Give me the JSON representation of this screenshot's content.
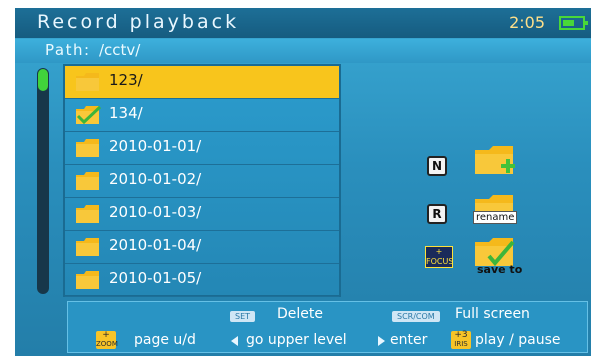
{
  "header": {
    "title": "Record playback",
    "time": "2:05",
    "battery_level": 0.6
  },
  "path": {
    "label": "Path:",
    "value": "/cctv/"
  },
  "colors": {
    "accent": "#f8c51c",
    "battery": "#49d838",
    "folder": "#f5b91b",
    "check": "#3db53a"
  },
  "scroll": {
    "position": 0
  },
  "files": [
    {
      "name": "123/",
      "selected": true,
      "checked": false
    },
    {
      "name": "134/",
      "selected": false,
      "checked": true
    },
    {
      "name": "2010-01-01/",
      "selected": false,
      "checked": false
    },
    {
      "name": "2010-01-02/",
      "selected": false,
      "checked": false
    },
    {
      "name": "2010-01-03/",
      "selected": false,
      "checked": false
    },
    {
      "name": "2010-01-04/",
      "selected": false,
      "checked": false
    },
    {
      "name": "2010-01-05/",
      "selected": false,
      "checked": false
    }
  ],
  "actions": {
    "new": {
      "key": "N",
      "icon": "folder-add-icon"
    },
    "rename": {
      "key": "R",
      "label": "rename",
      "icon": "folder-rename-icon"
    },
    "save": {
      "key_top": "+",
      "key_bottom": "FOCUS",
      "label": "save to",
      "icon": "folder-save-icon"
    }
  },
  "help": {
    "row1": [
      {
        "key": "SET",
        "text": "Delete"
      },
      {
        "key": "SCR/COM",
        "text": "Full screen"
      }
    ],
    "row2": [
      {
        "key_top": "+",
        "key_bottom": "ZOOM",
        "text": "page u/d"
      },
      {
        "arrow": "left",
        "text": "go upper level"
      },
      {
        "arrow": "right",
        "text": "enter"
      },
      {
        "key_top": "+3",
        "key_bottom": "IRIS",
        "text": "play / pause"
      }
    ]
  }
}
